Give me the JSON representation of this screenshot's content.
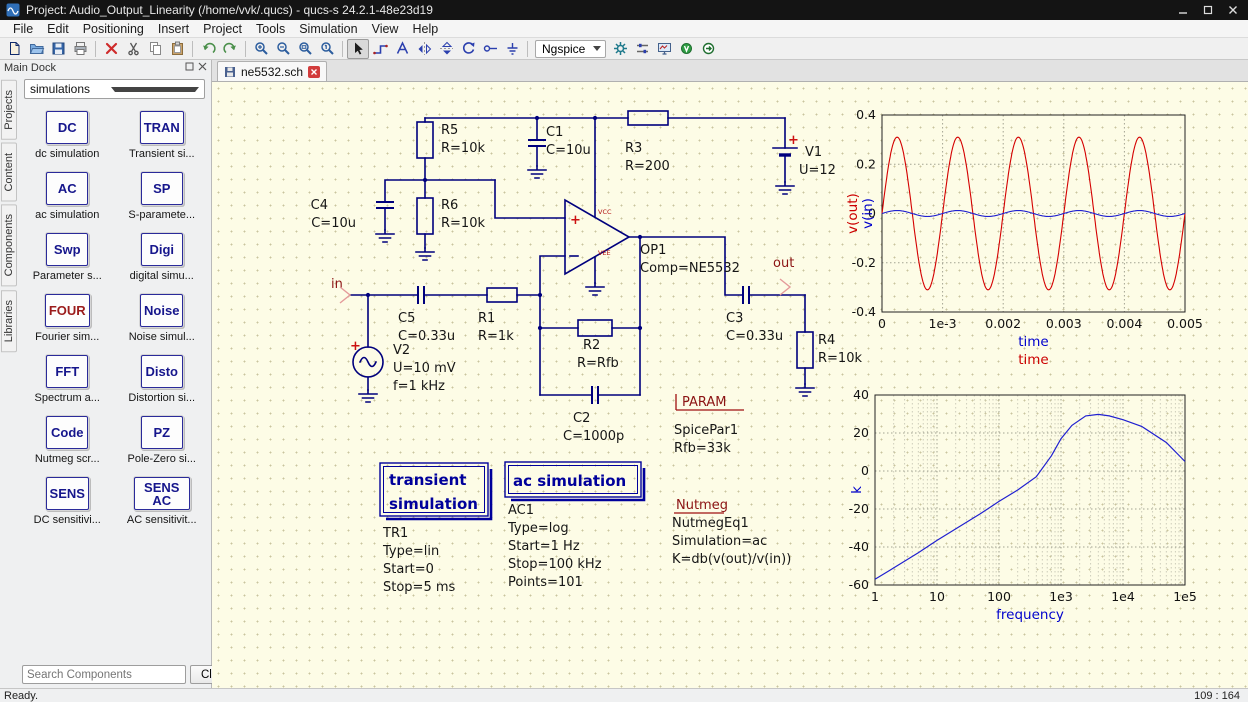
{
  "window": {
    "title": "Project: Audio_Output_Linearity (/home/vvk/.qucs) - qucs-s 24.2.1-48e23d19"
  },
  "menus": [
    "File",
    "Edit",
    "Positioning",
    "Insert",
    "Project",
    "Tools",
    "Simulation",
    "View",
    "Help"
  ],
  "toolbar": {
    "engine": "Ngspice",
    "icons": [
      "new-file",
      "open-file",
      "save",
      "print",
      "delete",
      "cut",
      "copy",
      "paste",
      "undo",
      "redo",
      "zoom-in",
      "zoom-out",
      "zoom-fit",
      "zoom-original",
      "select",
      "insert-wire",
      "insert-label",
      "mirror-vertical-axis",
      "mirror-horizontal-axis",
      "rotate",
      "insert-port",
      "insert-ground",
      "simulate",
      "simulation-settings",
      "display-data",
      "voltage-probe",
      "current-probe"
    ]
  },
  "dock": {
    "title": "Main Dock",
    "tabs": [
      {
        "label": "Projects"
      },
      {
        "label": "Content"
      },
      {
        "label": "Components"
      },
      {
        "label": "Libraries"
      }
    ],
    "category": "simulations",
    "items": [
      {
        "label": "DC",
        "caption": "dc simulation"
      },
      {
        "label": "TRAN",
        "caption": "Transient si..."
      },
      {
        "label": "AC",
        "caption": "ac simulation"
      },
      {
        "label": "SP",
        "caption": "S-paramete..."
      },
      {
        "label": "Swp",
        "caption": "Parameter s..."
      },
      {
        "label": "Digi",
        "caption": "digital simu..."
      },
      {
        "label": "FOUR",
        "caption": "Fourier sim...",
        "style": "color:#9b1b1b"
      },
      {
        "label": "Noise",
        "caption": "Noise simul..."
      },
      {
        "label": "FFT",
        "caption": "Spectrum a..."
      },
      {
        "label": "Disto",
        "caption": "Distortion si..."
      },
      {
        "label": "Code",
        "caption": "Nutmeg scr..."
      },
      {
        "label": "PZ",
        "caption": "Pole-Zero si..."
      },
      {
        "label": "SENS",
        "caption": "DC sensitivi..."
      },
      {
        "label": "SENS AC",
        "caption": "AC sensitivit..."
      }
    ],
    "search_placeholder": "Search Components",
    "clear_button": "Clear"
  },
  "tab": {
    "label": "ne5532.sch"
  },
  "schematic": {
    "components": {
      "r5": {
        "name": "R5",
        "value": "R=10k"
      },
      "r6": {
        "name": "R6",
        "value": "R=10k"
      },
      "r1": {
        "name": "R1",
        "value": "R=1k"
      },
      "r2": {
        "name": "R2",
        "value": "R=Rfb"
      },
      "r3": {
        "name": "R3",
        "value": "R=200"
      },
      "r4": {
        "name": "R4",
        "value": "R=10k"
      },
      "c1": {
        "name": "C1",
        "value": "C=10u"
      },
      "c2": {
        "name": "C2",
        "value": "C=1000p"
      },
      "c3": {
        "name": "C3",
        "value": "C=0.33u"
      },
      "c4": {
        "name": "C4",
        "value": "C=10u"
      },
      "c5": {
        "name": "C5",
        "value": "C=0.33u"
      },
      "v1": {
        "name": "V1",
        "value": "U=12"
      },
      "v2": {
        "name": "V2",
        "value": "U=10 mV",
        "value2": "f=1 kHz"
      },
      "op1": {
        "name": "OP1",
        "value": "Comp=NE5532",
        "vcc": "VCC",
        "vee": "VEE"
      }
    },
    "plus": "+",
    "ports": {
      "input": "in",
      "output": "out"
    },
    "param": {
      "title": "PARAM",
      "name": "SpicePar1",
      "line1": "Rfb=33k"
    },
    "nutmeg": {
      "title": "Nutmeg",
      "name": "NutmegEq1",
      "line1": "Simulation=ac",
      "line2": "K=db(v(out)/v(in))"
    },
    "transient": {
      "title_line1": "transient",
      "title_line2": "simulation",
      "name": "TR1",
      "line1": "Type=lin",
      "line2": "Start=0",
      "line3": "Stop=5 ms"
    },
    "ac": {
      "title": "ac simulation",
      "name": "AC1",
      "line1": "Type=log",
      "line2": "Start=1 Hz",
      "line3": "Stop=100 kHz",
      "line4": "Points=101"
    }
  },
  "chart_data": [
    {
      "type": "line",
      "name": "transient-waveforms",
      "xlim": [
        0,
        0.005
      ],
      "ylim": [
        -0.4,
        0.4
      ],
      "x_ticks": [
        "0",
        "1e-3",
        "0.002",
        "0.003",
        "0.004",
        "0.005"
      ],
      "y_ticks": [
        "0.4",
        "0.2",
        "0",
        "-0.2",
        "-0.4"
      ],
      "x_axis_labels": [
        {
          "text": "time",
          "color": "#0000cc"
        },
        {
          "text": "time",
          "color": "#cc0000"
        }
      ],
      "y_axis_labels": [
        {
          "text": "v(out)",
          "color": "#cc0000"
        },
        {
          "text": "v(in)",
          "color": "#0000cc"
        }
      ],
      "grid": true,
      "series": [
        {
          "name": "v(out)",
          "color": "#d40000",
          "waveform": "sine",
          "amplitude": 0.31,
          "frequency_hz": 1000,
          "phase_deg": 0
        },
        {
          "name": "v(in)",
          "color": "#2020d0",
          "waveform": "sine",
          "amplitude": 0.012,
          "frequency_hz": 1000,
          "phase_deg": 0
        }
      ]
    },
    {
      "type": "line",
      "name": "ac-response",
      "x_scale": "log",
      "xlim": [
        1,
        100000
      ],
      "ylim": [
        -60,
        40
      ],
      "x_ticks": [
        "1",
        "10",
        "100",
        "1e3",
        "1e4",
        "1e5"
      ],
      "y_ticks": [
        "40",
        "20",
        "0",
        "-20",
        "-40",
        "-60"
      ],
      "x_axis_label": {
        "text": "frequency",
        "color": "#0000cc"
      },
      "y_axis_label": {
        "text": "k",
        "color": "#0000cc"
      },
      "grid": true,
      "series": [
        {
          "name": "K=db(v(out)/v(in))",
          "color": "#2020d0",
          "points": [
            [
              1,
              -57
            ],
            [
              2,
              -51
            ],
            [
              5,
              -43
            ],
            [
              10,
              -36.5
            ],
            [
              20,
              -30.5
            ],
            [
              50,
              -22.5
            ],
            [
              100,
              -16
            ],
            [
              200,
              -10
            ],
            [
              400,
              -3
            ],
            [
              700,
              8
            ],
            [
              1000,
              17
            ],
            [
              1500,
              24
            ],
            [
              2500,
              29
            ],
            [
              4000,
              29.8
            ],
            [
              6000,
              29
            ],
            [
              10000,
              27
            ],
            [
              20000,
              23.5
            ],
            [
              50000,
              15
            ],
            [
              100000,
              5
            ]
          ]
        }
      ]
    }
  ],
  "statusbar": {
    "left": "Ready.",
    "right": "109 : 164"
  }
}
